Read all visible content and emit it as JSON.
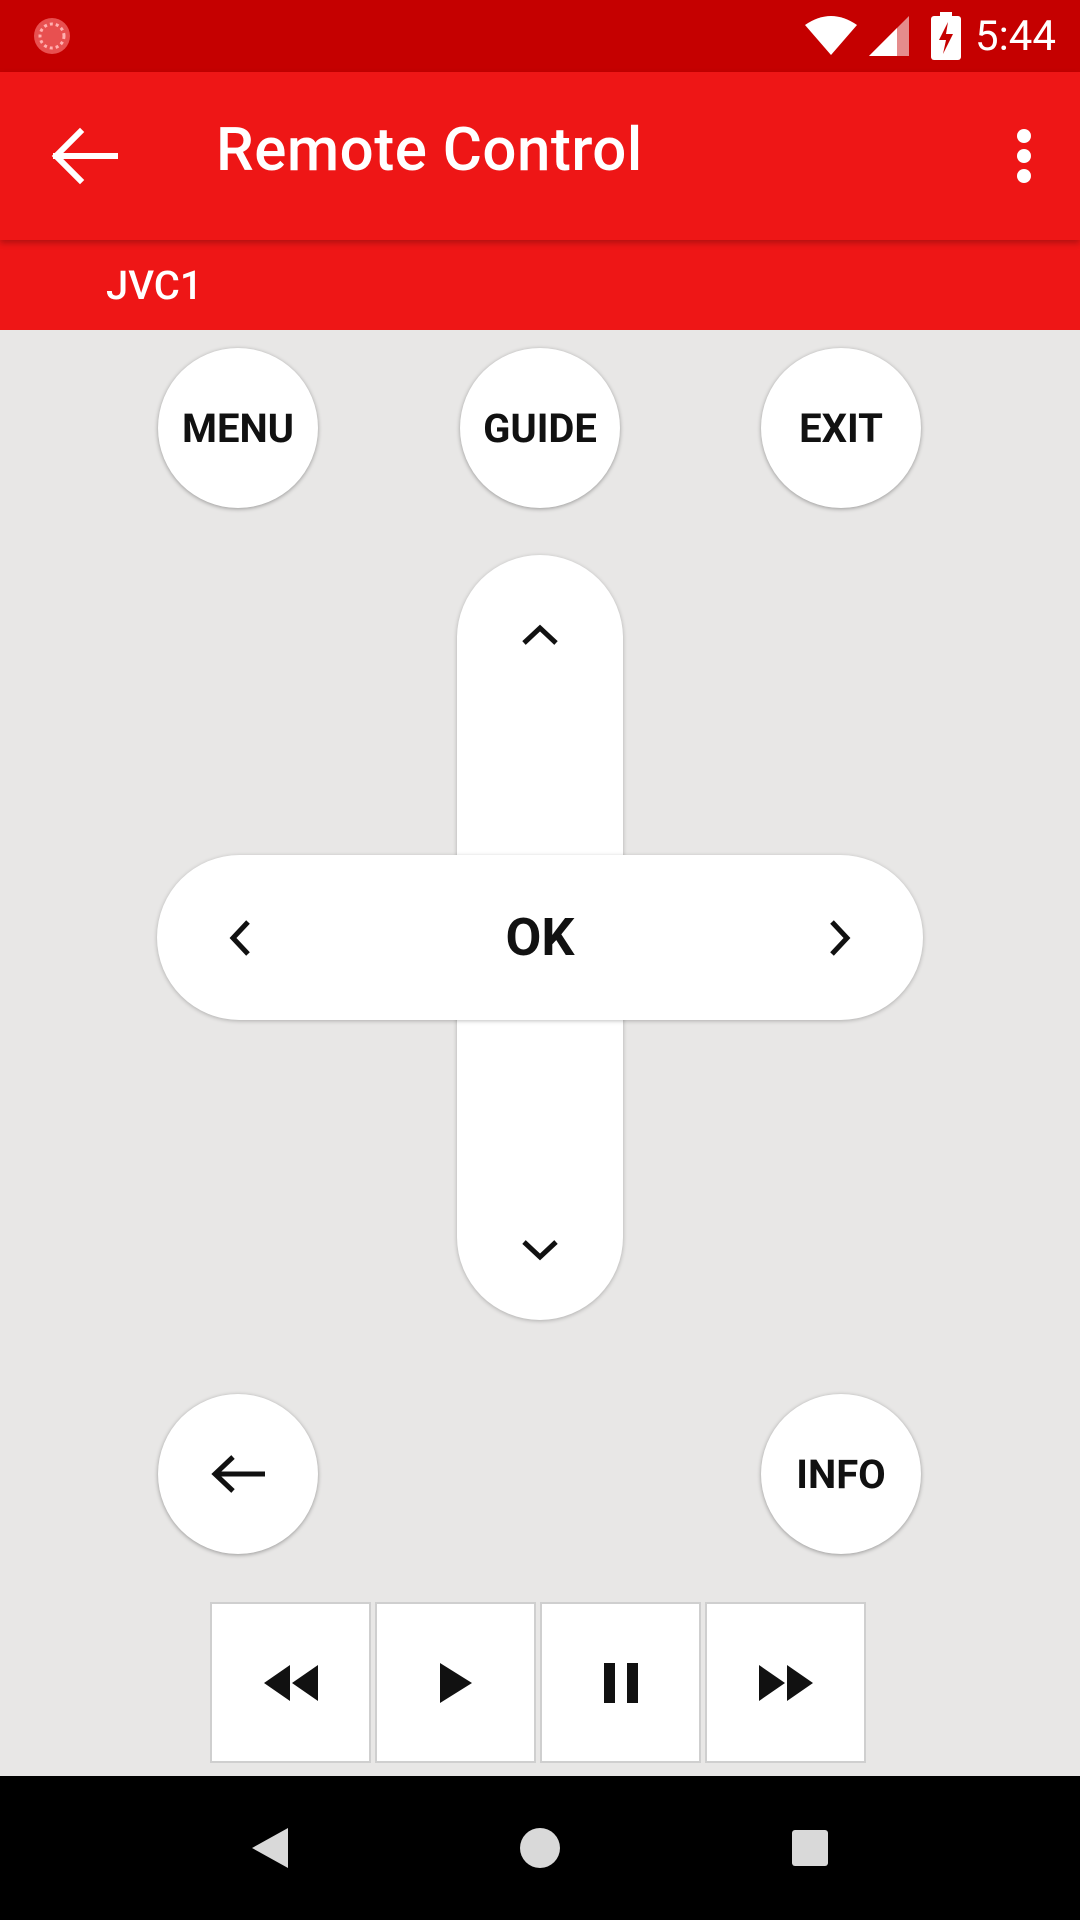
{
  "status_bar": {
    "time": "5:44",
    "icons": [
      "notification-icon",
      "wifi-icon",
      "signal-icon",
      "battery-charging-icon"
    ]
  },
  "app_bar": {
    "title": "Remote Control",
    "back_icon": "arrow-back-icon",
    "overflow_icon": "more-vert-icon"
  },
  "device": {
    "name": "JVC1"
  },
  "buttons": {
    "menu": "MENU",
    "guide": "GUIDE",
    "exit": "EXIT",
    "ok": "OK",
    "info": "INFO",
    "back_icon": "arrow-left-icon"
  },
  "dpad": {
    "up_icon": "chevron-up-icon",
    "down_icon": "chevron-down-icon",
    "left_icon": "chevron-left-icon",
    "right_icon": "chevron-right-icon"
  },
  "media": [
    {
      "name": "rewind",
      "icon": "rewind-icon"
    },
    {
      "name": "play",
      "icon": "play-icon"
    },
    {
      "name": "pause",
      "icon": "pause-icon"
    },
    {
      "name": "fast-forward",
      "icon": "fast-forward-icon"
    }
  ],
  "nav_bar": {
    "icons": [
      "nav-back-icon",
      "nav-home-icon",
      "nav-recents-icon"
    ]
  },
  "colors": {
    "status_bar": "#c50000",
    "app_bar": "#ee1616",
    "background": "#e8e7e6"
  }
}
